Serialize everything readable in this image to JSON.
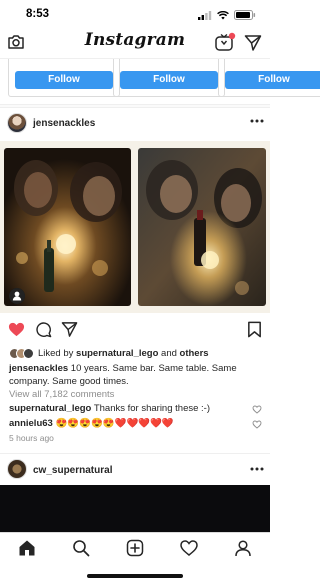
{
  "status_bar": {
    "time": "8:53"
  },
  "nav": {
    "brand": "Instagram"
  },
  "suggestions": {
    "follow_label": "Follow"
  },
  "post": {
    "username": "jensenackles",
    "liked_by_prefix": "Liked by ",
    "liked_by_user": "supernatural_lego",
    "liked_by_and": " and ",
    "liked_by_others": "others",
    "caption_user": "jensenackles",
    "caption_text": " 10 years.  Same bar.  Same table.  Same company.  Same good times.",
    "view_comments": "View all 7,182 comments",
    "comments": [
      {
        "user": "supernatural_lego",
        "text": " Thanks for sharing these :-)"
      },
      {
        "user": "annielu63",
        "text": " 😍😍😍😍😍❤️❤️❤️❤️❤️"
      }
    ],
    "timestamp": "5 hours ago"
  },
  "post2": {
    "username": "cw_supernatural"
  },
  "icons": {
    "camera": "camera-icon",
    "igtv": "igtv-icon",
    "direct": "paper-plane-icon",
    "more": "more-dots-icon",
    "user_tag": "user-tag-icon",
    "like": "heart-icon",
    "comment": "comment-icon",
    "share": "share-icon",
    "save": "bookmark-icon",
    "home": "home-icon",
    "search": "search-icon",
    "new_post": "plus-square-icon",
    "activity": "heart-outline-icon",
    "profile": "profile-icon"
  },
  "colors": {
    "accent": "#3897f0",
    "like": "#ed4956",
    "notification": "#ed4956"
  }
}
